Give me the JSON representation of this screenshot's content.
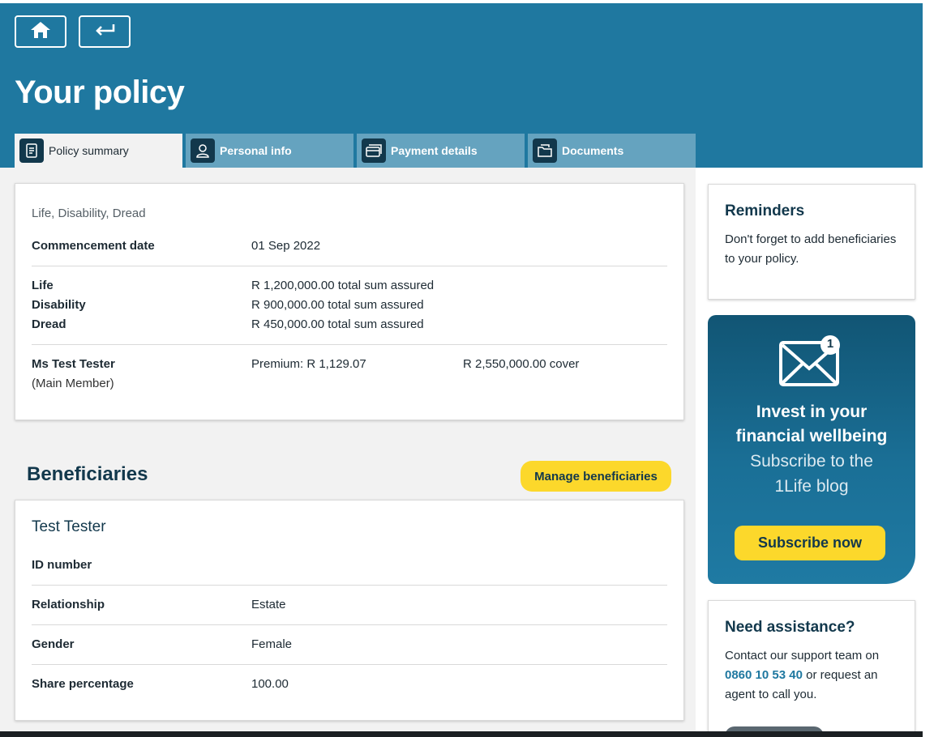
{
  "header": {
    "title": "Your policy",
    "home_icon": "home-icon",
    "back_icon": "back-arrow-icon",
    "bg_color": "#1f78a0"
  },
  "tabs": [
    {
      "label": "Policy summary",
      "icon": "document-list-icon",
      "active": true
    },
    {
      "label": "Personal info",
      "icon": "person-icon",
      "active": false
    },
    {
      "label": "Payment details",
      "icon": "credit-card-icon",
      "active": false
    },
    {
      "label": "Documents",
      "icon": "folder-icon",
      "active": false
    }
  ],
  "policy": {
    "product": "Life, Disability, Dread",
    "commencement_label": "Commencement date",
    "commencement_value": "01 Sep 2022",
    "covers": [
      {
        "label": "Life",
        "value": "R 1,200,000.00 total sum assured"
      },
      {
        "label": "Disability",
        "value": "R 900,000.00 total sum assured"
      },
      {
        "label": "Dread",
        "value": "R 450,000.00 total sum assured"
      }
    ],
    "member_name": "Ms Test Tester",
    "member_role": "(Main Member)",
    "premium": "Premium: R 1,129.07",
    "total_cover": "R 2,550,000.00 cover"
  },
  "beneficiaries": {
    "title": "Beneficiaries",
    "manage_label": "Manage beneficiaries",
    "name": "Test Tester",
    "fields": [
      {
        "label": "ID number",
        "value": ""
      },
      {
        "label": "Relationship",
        "value": "Estate"
      },
      {
        "label": "Gender",
        "value": "Female"
      },
      {
        "label": "Share percentage",
        "value": "100.00"
      }
    ]
  },
  "reminders": {
    "title": "Reminders",
    "text": "Don't forget to add beneficiaries to your policy."
  },
  "promo": {
    "badge": "1",
    "line1": "Invest in your",
    "line2": "financial wellbeing",
    "line3": "Subscribe to the",
    "line4": "1Life blog",
    "button": "Subscribe now",
    "accent": "#fcd82b"
  },
  "assist": {
    "title": "Need assistance?",
    "text_before": "Contact our support team on",
    "phone": "0860 10 53 40",
    "text_after": "or request an agent to call you."
  }
}
